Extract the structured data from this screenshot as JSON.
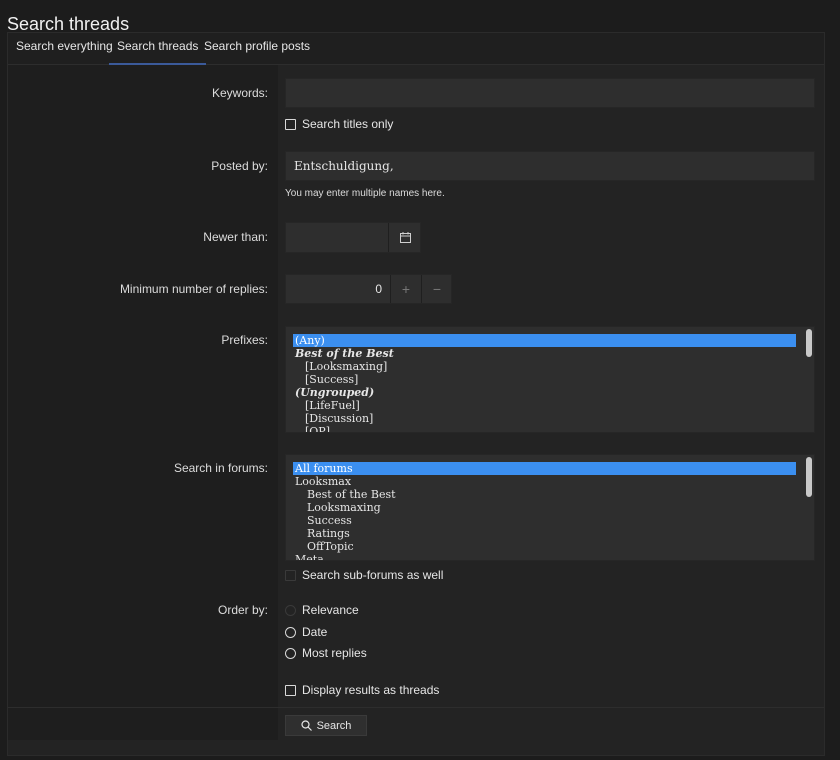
{
  "page": {
    "title": "Search threads"
  },
  "tabs": [
    {
      "label": "Search everything",
      "active": false
    },
    {
      "label": "Search threads",
      "active": true
    },
    {
      "label": "Search profile posts",
      "active": false
    }
  ],
  "form": {
    "keywords": {
      "label": "Keywords:",
      "value": "",
      "titles_only_label": "Search titles only",
      "titles_only_checked": false
    },
    "posted_by": {
      "label": "Posted by:",
      "value": "Entschuldigung,",
      "hint": "You may enter multiple names here."
    },
    "newer_than": {
      "label": "Newer than:",
      "value": "",
      "icon": "calendar-icon"
    },
    "min_replies": {
      "label": "Minimum number of replies:",
      "value": "0",
      "increment": "+",
      "decrement": "−"
    },
    "prefixes": {
      "label": "Prefixes:",
      "items": [
        {
          "text": "(Any)",
          "selected": true,
          "kind": "option"
        },
        {
          "text": "Best of the Best",
          "kind": "group"
        },
        {
          "text": "[Looksmaxing]",
          "kind": "child"
        },
        {
          "text": "[Success]",
          "kind": "child"
        },
        {
          "text": "(Ungrouped)",
          "kind": "group"
        },
        {
          "text": "[LifeFuel]",
          "kind": "child"
        },
        {
          "text": "[Discussion]",
          "kind": "child"
        },
        {
          "text": "[OP]",
          "kind": "child"
        }
      ]
    },
    "forums": {
      "label": "Search in forums:",
      "items": [
        {
          "text": "All forums",
          "selected": true,
          "kind": "option"
        },
        {
          "text": "Looksmax",
          "kind": "option"
        },
        {
          "text": "Best of the Best",
          "kind": "child"
        },
        {
          "text": "Looksmaxing",
          "kind": "child"
        },
        {
          "text": "Success",
          "kind": "child"
        },
        {
          "text": "Ratings",
          "kind": "child"
        },
        {
          "text": "OffTopic",
          "kind": "child"
        },
        {
          "text": "Meta",
          "kind": "option"
        }
      ],
      "sub_forums_label": "Search sub-forums as well",
      "sub_forums_checked": true
    },
    "order_by": {
      "label": "Order by:",
      "options": [
        {
          "label": "Relevance",
          "checked": true
        },
        {
          "label": "Date",
          "checked": false
        },
        {
          "label": "Most replies",
          "checked": false
        }
      ]
    },
    "display_as_threads": {
      "label": "Display results as threads",
      "checked": false
    },
    "submit": {
      "label": "Search"
    }
  },
  "colors": {
    "accent": "#3b8ff0",
    "tab_underline": "#3b5a9a",
    "background": "#1c1c1c"
  }
}
